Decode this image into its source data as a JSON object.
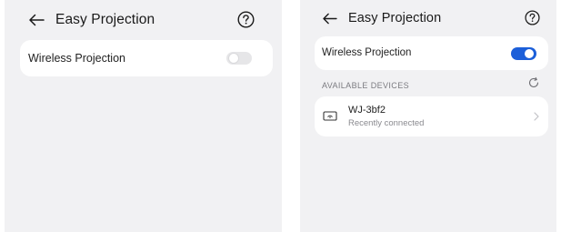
{
  "left": {
    "header": {
      "title": "Easy Projection"
    },
    "wireless": {
      "label": "Wireless Projection",
      "enabled": false
    }
  },
  "right": {
    "header": {
      "title": "Easy Projection"
    },
    "wireless": {
      "label": "Wireless Projection",
      "enabled": true
    },
    "section": {
      "label": "AVAILABLE DEVICES"
    },
    "devices": [
      {
        "name": "WJ-3bf2",
        "status": "Recently connected"
      }
    ]
  },
  "colors": {
    "accent": "#1c5fd9",
    "background": "#f1f1f3",
    "card": "#ffffff"
  },
  "icons": [
    "back-arrow-icon",
    "help-icon",
    "refresh-icon",
    "tv-icon",
    "chevron-right-icon"
  ]
}
